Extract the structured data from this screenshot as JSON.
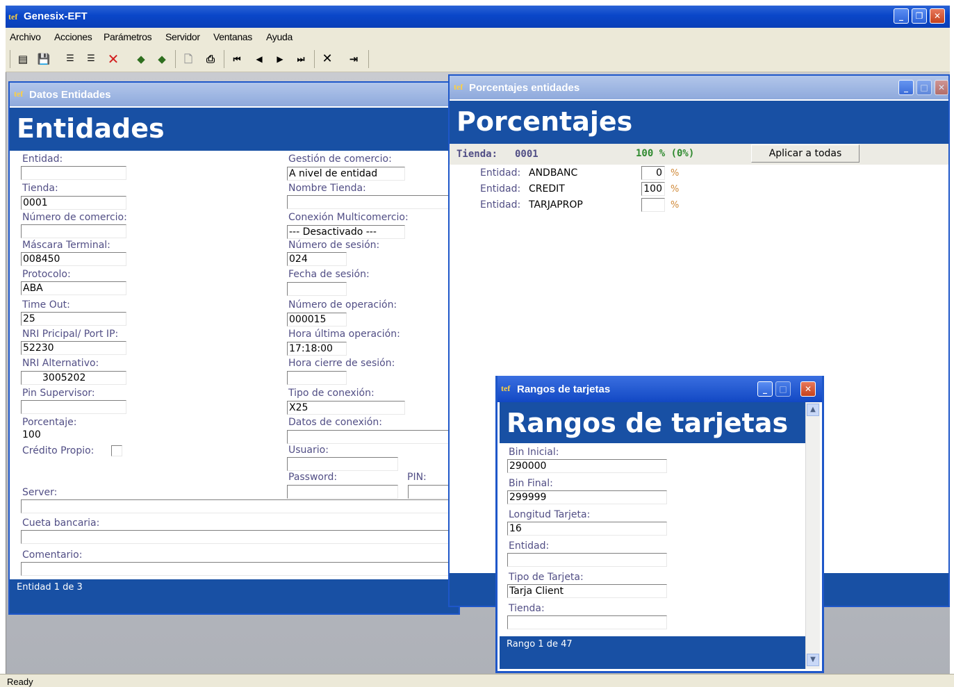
{
  "app": {
    "title": "Genesix-EFT",
    "icon_text": "tef"
  },
  "menu": [
    "Archivo",
    "Acciones",
    "Parámetros",
    "Servidor",
    "Ventanas",
    "Ayuda"
  ],
  "toolbar": [
    "edit-icon",
    "save-icon",
    "indent-icon",
    "outdent-icon",
    "delete-icon",
    "import-icon",
    "export-icon",
    "preview-icon",
    "print-icon",
    "first-record-icon",
    "prev-record-icon",
    "next-record-icon",
    "last-record-icon",
    "cancel-icon",
    "exit-icon"
  ],
  "entidades": {
    "window_title": "Datos Entidades",
    "header": "Entidades",
    "left_labels": {
      "entidad": "Entidad:",
      "tienda": "Tienda:",
      "numero_comercio": "Número de comercio:",
      "mascara": "Máscara Terminal:",
      "protocolo": "Protocolo:",
      "timeout": "Time Out:",
      "nri_principal": "NRI Pricipal/ Port IP:",
      "nri_alternativo": "NRI Alternativo:",
      "pin_supervisor": "Pin Supervisor:",
      "porcentaje": "Porcentaje:",
      "credito_propio": "Crédito Propio:",
      "server": "Server:",
      "cuenta": "Cueta bancaria:",
      "comentario": "Comentario:"
    },
    "left_values": {
      "entidad": "",
      "tienda": "0001",
      "numero_comercio": "",
      "mascara": "008450",
      "protocolo": "ABA",
      "timeout": "25",
      "nri_principal": "52230",
      "nri_alternativo": "3005202",
      "pin_supervisor": "",
      "porcentaje": "100",
      "server": "",
      "cuenta": "",
      "comentario": ""
    },
    "right_labels": {
      "gestion": "Gestión de comercio:",
      "nombre_tienda": "Nombre Tienda:",
      "conexion_multi": "Conexión Multicomercio:",
      "num_sesion": "Número de sesión:",
      "fecha_sesion": "Fecha de sesión:",
      "num_operacion": "Número de operación:",
      "hora_ultima": "Hora última operación:",
      "hora_cierre": "Hora cierre de sesión:",
      "tipo_conexion": "Tipo de conexión:",
      "datos_conexion": "Datos de conexión:",
      "usuario": "Usuario:",
      "password": "Password:",
      "pin": "PIN:"
    },
    "right_values": {
      "gestion": "A nivel de entidad",
      "nombre_tienda": "",
      "conexion_multi": "--- Desactivado ---",
      "num_sesion": "024",
      "fecha_sesion": "",
      "num_operacion": "000015",
      "hora_ultima": "17:18:00",
      "hora_cierre": "",
      "tipo_conexion": "X25",
      "datos_conexion": "",
      "usuario": "",
      "password": "",
      "pin": ""
    },
    "status": "Entidad 1 de 3"
  },
  "porcentajes": {
    "window_title": "Porcentajes entidades",
    "header": "Porcentajes",
    "tienda_label": "Tienda:",
    "tienda_value": "0001",
    "total": "100 % (0%)",
    "apply_button": "Aplicar a todas",
    "rows": [
      {
        "label": "Entidad:",
        "name": "ANDBANC",
        "value": "0"
      },
      {
        "label": "Entidad:",
        "name": "CREDIT",
        "value": "100"
      },
      {
        "label": "Entidad:",
        "name": "TARJAPROP",
        "value": ""
      }
    ],
    "pct_sign": "%"
  },
  "rangos": {
    "window_title": "Rangos de tarjetas",
    "header": "Rangos de tarjetas",
    "labels": {
      "bin_inicial": "Bin Inicial:",
      "bin_final": "Bin Final:",
      "longitud": "Longitud Tarjeta:",
      "entidad": "Entidad:",
      "tipo": "Tipo de Tarjeta:",
      "tienda": "Tienda:"
    },
    "values": {
      "bin_inicial": "290000",
      "bin_final": "299999",
      "longitud": "16",
      "entidad": "",
      "tipo": "Tarja Client",
      "tienda": ""
    },
    "status": "Rango 1 de 47"
  },
  "statusbar": "Ready",
  "colors": {
    "band": "#1850a4",
    "label": "#514e85",
    "green": "#2f8a2f",
    "title_blue": "#0a46c8"
  }
}
